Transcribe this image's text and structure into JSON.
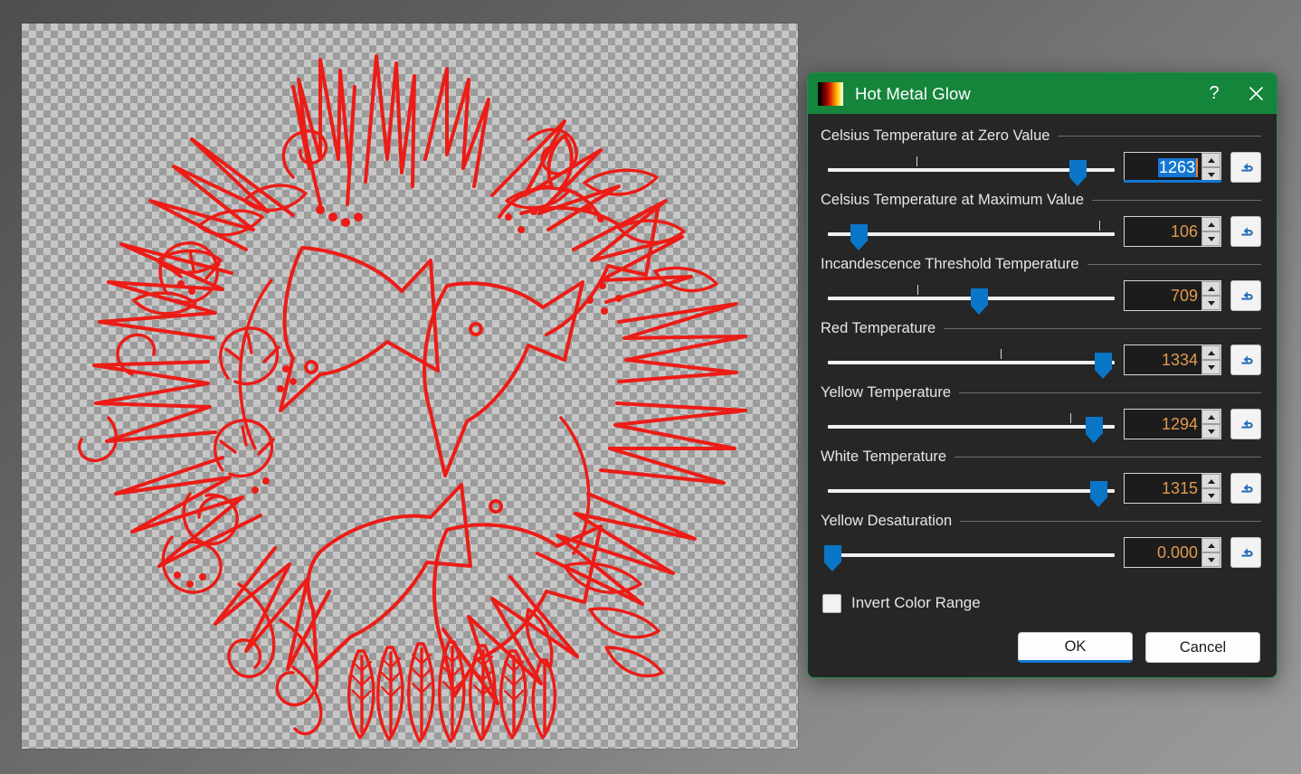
{
  "window": {
    "title": "Hot Metal Glow",
    "icon": "hot-metal-gradient-icon",
    "help_label": "?",
    "close_label": "×",
    "titlebar_color": "#15853c",
    "border_color": "#1f9245",
    "body_color": "#262626"
  },
  "canvas": {
    "description": "red line-art circular wreath of birds, leaves and flowers on transparency checkerboard",
    "stroke_color": "#ec1c16",
    "checker_light": "#c6c6c6",
    "checker_dark": "#9c9c9c"
  },
  "controls": [
    {
      "label": "Celsius Temperature at Zero Value",
      "value": "1263",
      "handle_pct": 84.5,
      "tick_pct": 30.0,
      "has_tick": true,
      "focused": true,
      "reset_icon": "reset-arrow-icon"
    },
    {
      "label": "Celsius Temperature at Maximum Value",
      "value": "106",
      "handle_pct": 10.5,
      "tick_pct": 92.0,
      "has_tick": true,
      "focused": false,
      "reset_icon": "reset-arrow-icon"
    },
    {
      "label": "Incandescence Threshold Temperature",
      "value": "709",
      "handle_pct": 51.0,
      "tick_pct": 30.5,
      "has_tick": true,
      "focused": false,
      "reset_icon": "reset-arrow-icon"
    },
    {
      "label": "Red Temperature",
      "value": "1334",
      "handle_pct": 93.0,
      "tick_pct": 58.5,
      "has_tick": true,
      "focused": false,
      "reset_icon": "reset-arrow-icon"
    },
    {
      "label": "Yellow Temperature",
      "value": "1294",
      "handle_pct": 90.0,
      "tick_pct": 82.0,
      "has_tick": true,
      "focused": false,
      "reset_icon": "reset-arrow-icon"
    },
    {
      "label": "White Temperature",
      "value": "1315",
      "handle_pct": 91.5,
      "tick_pct": 0,
      "has_tick": false,
      "focused": false,
      "reset_icon": "reset-arrow-icon"
    },
    {
      "label": "Yellow Desaturation",
      "value": "0.000",
      "handle_pct": 1.5,
      "tick_pct": 0,
      "has_tick": false,
      "focused": false,
      "reset_icon": "reset-arrow-icon"
    }
  ],
  "checkbox": {
    "label": "Invert Color Range",
    "checked": false
  },
  "buttons": {
    "ok": "OK",
    "cancel": "Cancel",
    "accent": "#1477d4"
  }
}
